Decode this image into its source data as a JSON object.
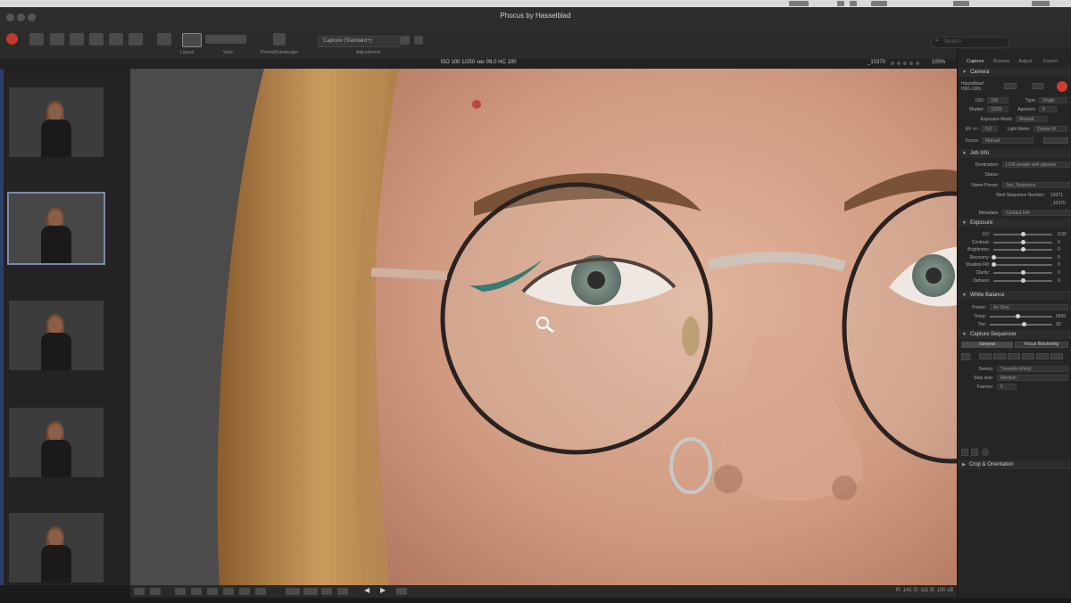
{
  "window": {
    "title": "Phocus by Hasselblad",
    "search_placeholder": "Search"
  },
  "toolbar": {
    "preset_value": "Capture (Standard+)",
    "labels": {
      "adjustments": "Adjustments",
      "portrait_landscape": "Portrait/Landscape",
      "view": "View",
      "layout": "Layout"
    }
  },
  "infobar": {
    "exif": "ISO 100  1/250 sec  f/8.0  HC 100",
    "frame_number": "_10370",
    "zoom": "100%"
  },
  "bottombar": {
    "readout": "R: 141  G: 111  B: 100  cB"
  },
  "panel": {
    "tabs": [
      "Capture",
      "Browse",
      "Adjust",
      "Export"
    ],
    "active_tab": "Capture",
    "camera": {
      "title": "Camera",
      "model": "Hasselblad H6D-100c",
      "iso_label": "ISO:",
      "iso": "100",
      "shutter_label": "Shutter:",
      "shutter": "1/250",
      "aperture_label": "Aperture:",
      "aperture": "8",
      "type_label": "Type:",
      "type": "Single",
      "exposure_mode_label": "Exposure Mode:",
      "exposure_mode": "Manual",
      "ev_label": "EV +/-:",
      "ev": "0.0",
      "light_meter_label": "Light Meter:",
      "light_meter": "Centre W",
      "focus_label": "Focus:",
      "focus": "Manual"
    },
    "job_info": {
      "title": "Job Info",
      "destination_label": "Destination:",
      "destination": "LIVE people with glasses",
      "name_preset_label": "Name Preset:",
      "name_preset": "Job_Sequence",
      "status_label": "Status:",
      "next_seq_label": "Next Sequence Number:",
      "next_seq": "10371",
      "sub_value": "_10370",
      "metadata_label": "Metadata:",
      "metadata": "Contact Info"
    },
    "exposure": {
      "title": "Exposure",
      "rows": [
        {
          "label": "EV:",
          "value": "0.00",
          "level": 0.5
        },
        {
          "label": "Contrast:",
          "value": "0",
          "level": 0.5
        },
        {
          "label": "Brightness:",
          "value": "0",
          "level": 0.5
        },
        {
          "label": "Recovery:",
          "value": "0",
          "level": 0.0
        },
        {
          "label": "Shadow Fill:",
          "value": "0",
          "level": 0.0
        },
        {
          "label": "Clarity:",
          "value": "0",
          "level": 0.5
        },
        {
          "label": "Dehaze:",
          "value": "0",
          "level": 0.5
        }
      ]
    },
    "white_balance": {
      "title": "White Balance",
      "preset_label": "Preset:",
      "preset": "As Shot",
      "temp_label": "Temp:",
      "temp": "5500",
      "temp_level": 0.45,
      "tint_label": "Tint:",
      "tint": "20",
      "tint_level": 0.55
    },
    "capture_sequencer": {
      "title": "Capture Sequencer",
      "tab_general": "General",
      "tab_focus": "Focus Bracketing",
      "sweep_label": "Sweep:",
      "sweep": "Towards Infinity",
      "step_label": "Step size:",
      "step": "Medium",
      "frames_label": "Frames:",
      "frames": "6"
    },
    "crop": {
      "title": "Crop & Orientation"
    }
  },
  "colors": {
    "accent": "#2c3f6a",
    "panel_bg": "#252525",
    "record": "#d23a2e"
  }
}
